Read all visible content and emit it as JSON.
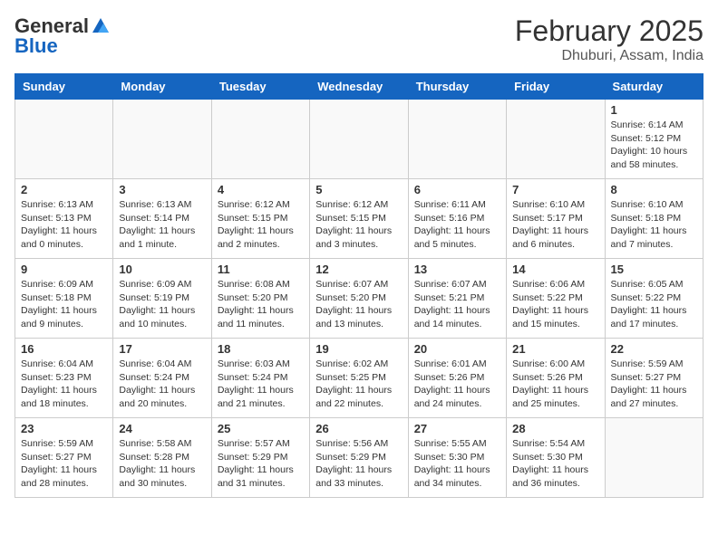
{
  "header": {
    "logo_general": "General",
    "logo_blue": "Blue",
    "month_title": "February 2025",
    "subtitle": "Dhuburi, Assam, India"
  },
  "days_of_week": [
    "Sunday",
    "Monday",
    "Tuesday",
    "Wednesday",
    "Thursday",
    "Friday",
    "Saturday"
  ],
  "weeks": [
    [
      {
        "day": "",
        "info": ""
      },
      {
        "day": "",
        "info": ""
      },
      {
        "day": "",
        "info": ""
      },
      {
        "day": "",
        "info": ""
      },
      {
        "day": "",
        "info": ""
      },
      {
        "day": "",
        "info": ""
      },
      {
        "day": "1",
        "info": "Sunrise: 6:14 AM\nSunset: 5:12 PM\nDaylight: 10 hours\nand 58 minutes."
      }
    ],
    [
      {
        "day": "2",
        "info": "Sunrise: 6:13 AM\nSunset: 5:13 PM\nDaylight: 11 hours\nand 0 minutes."
      },
      {
        "day": "3",
        "info": "Sunrise: 6:13 AM\nSunset: 5:14 PM\nDaylight: 11 hours\nand 1 minute."
      },
      {
        "day": "4",
        "info": "Sunrise: 6:12 AM\nSunset: 5:15 PM\nDaylight: 11 hours\nand 2 minutes."
      },
      {
        "day": "5",
        "info": "Sunrise: 6:12 AM\nSunset: 5:15 PM\nDaylight: 11 hours\nand 3 minutes."
      },
      {
        "day": "6",
        "info": "Sunrise: 6:11 AM\nSunset: 5:16 PM\nDaylight: 11 hours\nand 5 minutes."
      },
      {
        "day": "7",
        "info": "Sunrise: 6:10 AM\nSunset: 5:17 PM\nDaylight: 11 hours\nand 6 minutes."
      },
      {
        "day": "8",
        "info": "Sunrise: 6:10 AM\nSunset: 5:18 PM\nDaylight: 11 hours\nand 7 minutes."
      }
    ],
    [
      {
        "day": "9",
        "info": "Sunrise: 6:09 AM\nSunset: 5:18 PM\nDaylight: 11 hours\nand 9 minutes."
      },
      {
        "day": "10",
        "info": "Sunrise: 6:09 AM\nSunset: 5:19 PM\nDaylight: 11 hours\nand 10 minutes."
      },
      {
        "day": "11",
        "info": "Sunrise: 6:08 AM\nSunset: 5:20 PM\nDaylight: 11 hours\nand 11 minutes."
      },
      {
        "day": "12",
        "info": "Sunrise: 6:07 AM\nSunset: 5:20 PM\nDaylight: 11 hours\nand 13 minutes."
      },
      {
        "day": "13",
        "info": "Sunrise: 6:07 AM\nSunset: 5:21 PM\nDaylight: 11 hours\nand 14 minutes."
      },
      {
        "day": "14",
        "info": "Sunrise: 6:06 AM\nSunset: 5:22 PM\nDaylight: 11 hours\nand 15 minutes."
      },
      {
        "day": "15",
        "info": "Sunrise: 6:05 AM\nSunset: 5:22 PM\nDaylight: 11 hours\nand 17 minutes."
      }
    ],
    [
      {
        "day": "16",
        "info": "Sunrise: 6:04 AM\nSunset: 5:23 PM\nDaylight: 11 hours\nand 18 minutes."
      },
      {
        "day": "17",
        "info": "Sunrise: 6:04 AM\nSunset: 5:24 PM\nDaylight: 11 hours\nand 20 minutes."
      },
      {
        "day": "18",
        "info": "Sunrise: 6:03 AM\nSunset: 5:24 PM\nDaylight: 11 hours\nand 21 minutes."
      },
      {
        "day": "19",
        "info": "Sunrise: 6:02 AM\nSunset: 5:25 PM\nDaylight: 11 hours\nand 22 minutes."
      },
      {
        "day": "20",
        "info": "Sunrise: 6:01 AM\nSunset: 5:26 PM\nDaylight: 11 hours\nand 24 minutes."
      },
      {
        "day": "21",
        "info": "Sunrise: 6:00 AM\nSunset: 5:26 PM\nDaylight: 11 hours\nand 25 minutes."
      },
      {
        "day": "22",
        "info": "Sunrise: 5:59 AM\nSunset: 5:27 PM\nDaylight: 11 hours\nand 27 minutes."
      }
    ],
    [
      {
        "day": "23",
        "info": "Sunrise: 5:59 AM\nSunset: 5:27 PM\nDaylight: 11 hours\nand 28 minutes."
      },
      {
        "day": "24",
        "info": "Sunrise: 5:58 AM\nSunset: 5:28 PM\nDaylight: 11 hours\nand 30 minutes."
      },
      {
        "day": "25",
        "info": "Sunrise: 5:57 AM\nSunset: 5:29 PM\nDaylight: 11 hours\nand 31 minutes."
      },
      {
        "day": "26",
        "info": "Sunrise: 5:56 AM\nSunset: 5:29 PM\nDaylight: 11 hours\nand 33 minutes."
      },
      {
        "day": "27",
        "info": "Sunrise: 5:55 AM\nSunset: 5:30 PM\nDaylight: 11 hours\nand 34 minutes."
      },
      {
        "day": "28",
        "info": "Sunrise: 5:54 AM\nSunset: 5:30 PM\nDaylight: 11 hours\nand 36 minutes."
      },
      {
        "day": "",
        "info": ""
      }
    ]
  ]
}
